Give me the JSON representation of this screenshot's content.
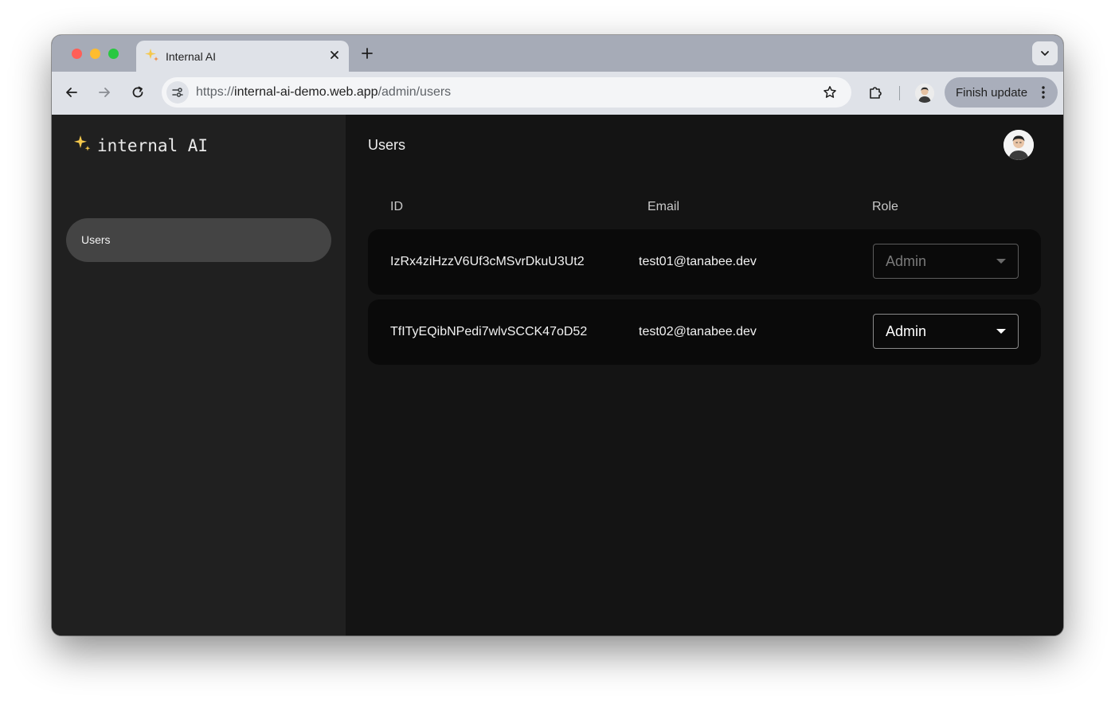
{
  "browser": {
    "tab_title": "Internal AI",
    "url_origin": "https://",
    "url_host": "internal-ai-demo.web.app",
    "url_path": "/admin/users",
    "finish_update_label": "Finish update"
  },
  "app": {
    "logo_text": "internal AI",
    "accent_color": "#f5c84c",
    "sidebar": {
      "items": [
        {
          "label": "Users",
          "active": true
        }
      ]
    },
    "page_title": "Users",
    "table": {
      "columns": [
        "ID",
        "Email",
        "Role"
      ],
      "rows": [
        {
          "id": "IzRx4ziHzzV6Uf3cMSvrDkuU3Ut2",
          "email": "test01@tanabee.dev",
          "role": "Admin",
          "role_disabled": true
        },
        {
          "id": "TfITyEQibNPedi7wlvSCCK47oD52",
          "email": "test02@tanabee.dev",
          "role": "Admin",
          "role_disabled": false
        }
      ]
    }
  }
}
